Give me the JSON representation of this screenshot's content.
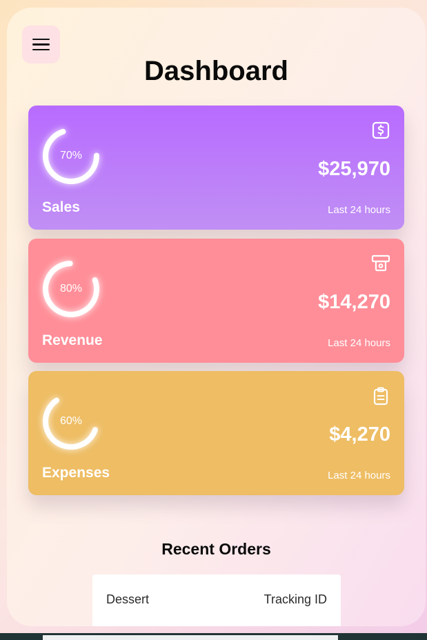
{
  "page": {
    "title": "Dashboard",
    "menu_icon": "hamburger-menu-icon"
  },
  "cards": [
    {
      "key": "sales",
      "label": "Sales",
      "value": "$25,970",
      "subtitle": "Last 24 hours",
      "percent": 70,
      "percent_label": "70%",
      "icon": "dollar-icon",
      "color": "#b86bff"
    },
    {
      "key": "revenue",
      "label": "Revenue",
      "value": "$14,270",
      "subtitle": "Last 24 hours",
      "percent": 80,
      "percent_label": "80%",
      "icon": "cash-icon",
      "color": "#ff8e98"
    },
    {
      "key": "expenses",
      "label": "Expenses",
      "value": "$4,270",
      "subtitle": "Last 24 hours",
      "percent": 60,
      "percent_label": "60%",
      "icon": "clipboard-icon",
      "color": "#eebd64"
    }
  ],
  "recent_orders": {
    "title": "Recent Orders",
    "columns": [
      "Dessert",
      "Tracking ID"
    ]
  }
}
